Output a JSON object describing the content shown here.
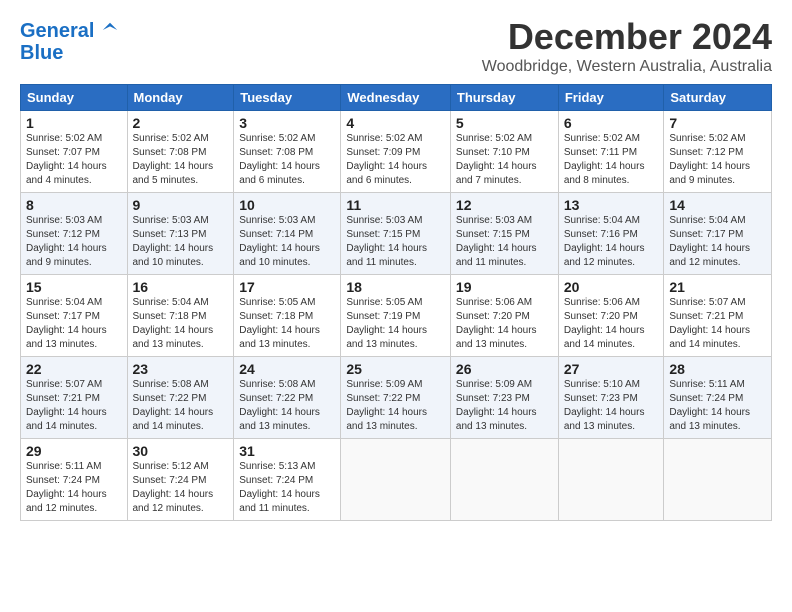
{
  "logo": {
    "text_general": "General",
    "text_blue": "Blue"
  },
  "title": "December 2024",
  "location": "Woodbridge, Western Australia, Australia",
  "weekdays": [
    "Sunday",
    "Monday",
    "Tuesday",
    "Wednesday",
    "Thursday",
    "Friday",
    "Saturday"
  ],
  "weeks": [
    [
      {
        "day": "1",
        "sunrise": "5:02 AM",
        "sunset": "7:07 PM",
        "daylight": "14 hours and 4 minutes."
      },
      {
        "day": "2",
        "sunrise": "5:02 AM",
        "sunset": "7:08 PM",
        "daylight": "14 hours and 5 minutes."
      },
      {
        "day": "3",
        "sunrise": "5:02 AM",
        "sunset": "7:08 PM",
        "daylight": "14 hours and 6 minutes."
      },
      {
        "day": "4",
        "sunrise": "5:02 AM",
        "sunset": "7:09 PM",
        "daylight": "14 hours and 6 minutes."
      },
      {
        "day": "5",
        "sunrise": "5:02 AM",
        "sunset": "7:10 PM",
        "daylight": "14 hours and 7 minutes."
      },
      {
        "day": "6",
        "sunrise": "5:02 AM",
        "sunset": "7:11 PM",
        "daylight": "14 hours and 8 minutes."
      },
      {
        "day": "7",
        "sunrise": "5:02 AM",
        "sunset": "7:12 PM",
        "daylight": "14 hours and 9 minutes."
      }
    ],
    [
      {
        "day": "8",
        "sunrise": "5:03 AM",
        "sunset": "7:12 PM",
        "daylight": "14 hours and 9 minutes."
      },
      {
        "day": "9",
        "sunrise": "5:03 AM",
        "sunset": "7:13 PM",
        "daylight": "14 hours and 10 minutes."
      },
      {
        "day": "10",
        "sunrise": "5:03 AM",
        "sunset": "7:14 PM",
        "daylight": "14 hours and 10 minutes."
      },
      {
        "day": "11",
        "sunrise": "5:03 AM",
        "sunset": "7:15 PM",
        "daylight": "14 hours and 11 minutes."
      },
      {
        "day": "12",
        "sunrise": "5:03 AM",
        "sunset": "7:15 PM",
        "daylight": "14 hours and 11 minutes."
      },
      {
        "day": "13",
        "sunrise": "5:04 AM",
        "sunset": "7:16 PM",
        "daylight": "14 hours and 12 minutes."
      },
      {
        "day": "14",
        "sunrise": "5:04 AM",
        "sunset": "7:17 PM",
        "daylight": "14 hours and 12 minutes."
      }
    ],
    [
      {
        "day": "15",
        "sunrise": "5:04 AM",
        "sunset": "7:17 PM",
        "daylight": "14 hours and 13 minutes."
      },
      {
        "day": "16",
        "sunrise": "5:04 AM",
        "sunset": "7:18 PM",
        "daylight": "14 hours and 13 minutes."
      },
      {
        "day": "17",
        "sunrise": "5:05 AM",
        "sunset": "7:18 PM",
        "daylight": "14 hours and 13 minutes."
      },
      {
        "day": "18",
        "sunrise": "5:05 AM",
        "sunset": "7:19 PM",
        "daylight": "14 hours and 13 minutes."
      },
      {
        "day": "19",
        "sunrise": "5:06 AM",
        "sunset": "7:20 PM",
        "daylight": "14 hours and 13 minutes."
      },
      {
        "day": "20",
        "sunrise": "5:06 AM",
        "sunset": "7:20 PM",
        "daylight": "14 hours and 14 minutes."
      },
      {
        "day": "21",
        "sunrise": "5:07 AM",
        "sunset": "7:21 PM",
        "daylight": "14 hours and 14 minutes."
      }
    ],
    [
      {
        "day": "22",
        "sunrise": "5:07 AM",
        "sunset": "7:21 PM",
        "daylight": "14 hours and 14 minutes."
      },
      {
        "day": "23",
        "sunrise": "5:08 AM",
        "sunset": "7:22 PM",
        "daylight": "14 hours and 14 minutes."
      },
      {
        "day": "24",
        "sunrise": "5:08 AM",
        "sunset": "7:22 PM",
        "daylight": "14 hours and 13 minutes."
      },
      {
        "day": "25",
        "sunrise": "5:09 AM",
        "sunset": "7:22 PM",
        "daylight": "14 hours and 13 minutes."
      },
      {
        "day": "26",
        "sunrise": "5:09 AM",
        "sunset": "7:23 PM",
        "daylight": "14 hours and 13 minutes."
      },
      {
        "day": "27",
        "sunrise": "5:10 AM",
        "sunset": "7:23 PM",
        "daylight": "14 hours and 13 minutes."
      },
      {
        "day": "28",
        "sunrise": "5:11 AM",
        "sunset": "7:24 PM",
        "daylight": "14 hours and 13 minutes."
      }
    ],
    [
      {
        "day": "29",
        "sunrise": "5:11 AM",
        "sunset": "7:24 PM",
        "daylight": "14 hours and 12 minutes."
      },
      {
        "day": "30",
        "sunrise": "5:12 AM",
        "sunset": "7:24 PM",
        "daylight": "14 hours and 12 minutes."
      },
      {
        "day": "31",
        "sunrise": "5:13 AM",
        "sunset": "7:24 PM",
        "daylight": "14 hours and 11 minutes."
      },
      null,
      null,
      null,
      null
    ]
  ],
  "labels": {
    "sunrise": "Sunrise:",
    "sunset": "Sunset:",
    "daylight": "Daylight:"
  }
}
